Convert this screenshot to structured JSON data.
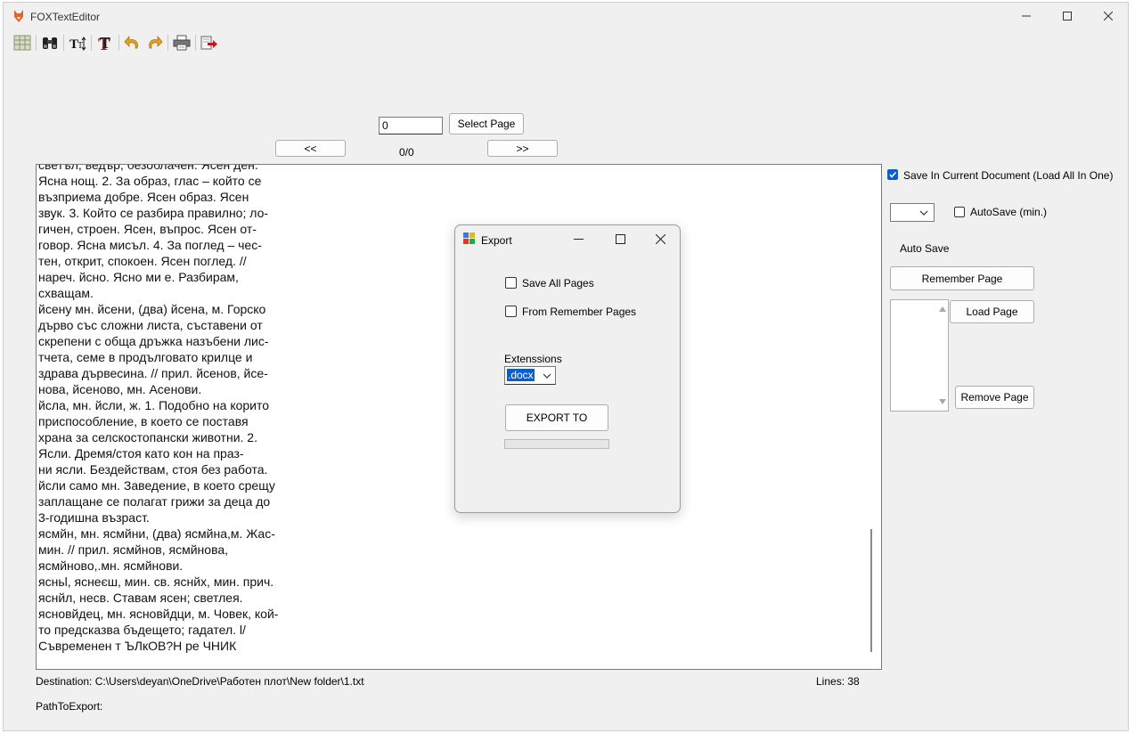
{
  "window": {
    "title": "FOXTextEditor",
    "controls": {
      "minimize": "minimize-icon",
      "maximize": "maximize-icon",
      "close": "close-icon"
    }
  },
  "toolbar": {
    "icons": [
      "new-doc-icon",
      "binoculars-icon",
      "text-size-icon",
      "text-format-icon",
      "undo-icon",
      "redo-icon",
      "print-icon",
      "export-icon"
    ]
  },
  "pager": {
    "page_input": "0",
    "select_button": "Select Page",
    "prev_button": "<<",
    "next_button": ">>",
    "page_status": "0/0"
  },
  "editor": {
    "lines": [
      "светъл, ведър, безоблачен. Ясен ден.",
      "Ясна нощ. 2. За образ, глас – който се",
      "възприема добре. Ясен образ. Ясен",
      "звук. 3. Който се разбира правилно; ло-",
      "гичен, строен. Ясен, въпрос. Ясен от-",
      "говор. Ясна мисъл. 4. За поглед – чес-",
      "тен, открит, спокоен. Ясен поглед. //",
      "нареч. йсно. Ясно ми е. Разбирам,",
      "схващам.",
      "йсену мн. йсени, (два) йсена, м. Горско",
      "дърво със сложни листа, съставени от",
      "скрепени с обща дръжка назъбени лис-",
      "тчета, семе в продълговато крилце и",
      "здрава дървесина. // прил. йсенов, йсе-",
      "нова, йсеново, мн. Асенови.",
      "йсла, мн. йсли, ж. 1. Подобно на корито",
      "приспособление, в което се поставя",
      "храна за селскостопански животни. 2.",
      "Ясли. Дремя/стоя като кон на праз-",
      "ни ясли. Бездействам, стоя без работа.",
      "йсли само мн. Заведение, в което срещу",
      "заплащане се полагат грижи за деца до",
      "3-годишна възраст.",
      "ясмйн, мн. ясмйни, (два) ясмйна,м. Жас-",
      "мин. // прил. ясмйнов, ясмйнова,",
      "ясмйново,.мн. ясмйнови.",
      "ясньl, яснеєш, мин. св. яснйх, мин. прич.",
      "яснйл, несв. Ставам ясен; светлея.",
      "ясновйдец, мн. ясновйдци, м. Човек, кой-",
      "то предсказва бъдещето; гадател. l/",
      "Съвременен т ЪЛкОВ?Н ре ЧНИК"
    ]
  },
  "status": {
    "destination": "Destination: C:\\Users\\deyan\\OneDrive\\Работен плот\\New folder\\1.txt",
    "lines": "Lines: 38",
    "path_to_export": "PathToExport:"
  },
  "sidebar": {
    "save_in_current": {
      "label": "Save In Current Document (Load All In One)",
      "checked": true
    },
    "autosave_select_value": "",
    "autosave_checkbox": {
      "label": "AutoSave (min.)",
      "checked": false
    },
    "autosave_label": "Auto Save",
    "remember_page": "Remember Page",
    "load_page": "Load Page",
    "remove_page": "Remove Page"
  },
  "export_dialog": {
    "title": "Export",
    "save_all_pages": {
      "label": "Save All Pages",
      "checked": false
    },
    "from_remember_pages": {
      "label": "From Remember Pages",
      "checked": false
    },
    "extensions_label": "Extenssions",
    "extension_value": ".docx",
    "export_button": "EXPORT TO",
    "progress": 0
  },
  "colors": {
    "accent": "#0a5fc8",
    "window_bg": "#f0f0f0"
  }
}
